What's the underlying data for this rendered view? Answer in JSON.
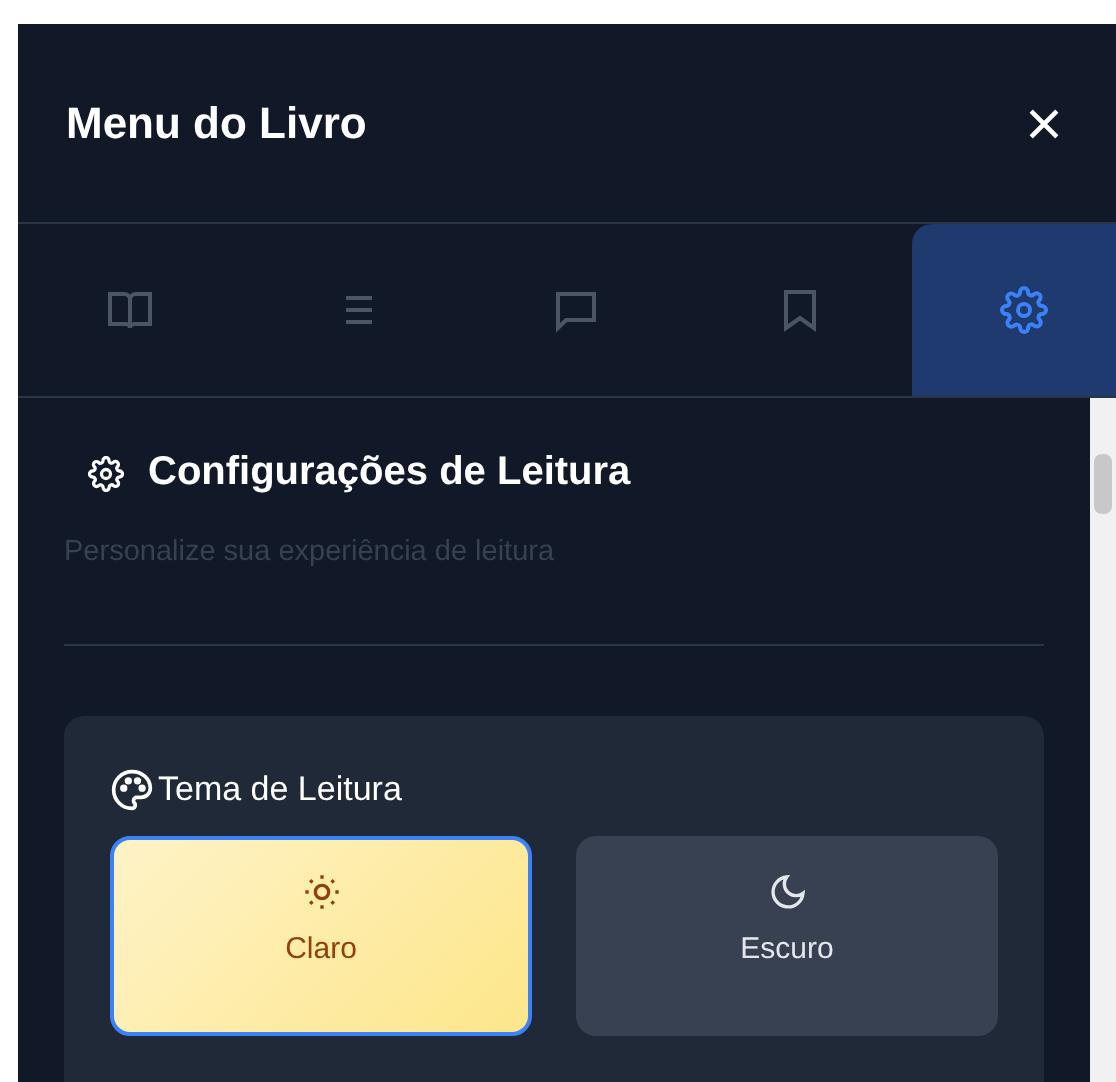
{
  "header": {
    "title": "Menu do Livro"
  },
  "tabs": [
    {
      "kind": "book",
      "selected": false
    },
    {
      "kind": "list",
      "selected": false
    },
    {
      "kind": "comment",
      "selected": false
    },
    {
      "kind": "bookmark",
      "selected": false
    },
    {
      "kind": "settings",
      "selected": true
    }
  ],
  "settings": {
    "title": "Configurações de Leitura",
    "subtitle": "Personalize sua experiência de leitura",
    "theme": {
      "title": "Tema de Leitura",
      "options": [
        {
          "kind": "sun",
          "label": "Claro",
          "selected": true
        },
        {
          "kind": "moon",
          "label": "Escuro",
          "selected": false
        }
      ]
    }
  }
}
